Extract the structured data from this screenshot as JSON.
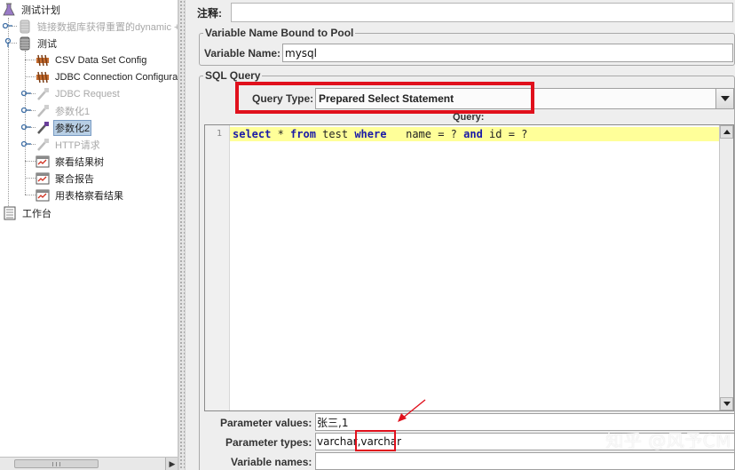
{
  "tree": {
    "nodes": [
      {
        "label": "测试计划",
        "icon": "flask-icon",
        "disabled": false,
        "selected": false
      },
      {
        "label": "链接数据库获得重置的dynamic +",
        "icon": "thread-group-icon",
        "disabled": true,
        "selected": false
      },
      {
        "label": "测试",
        "icon": "thread-group-icon",
        "disabled": false,
        "selected": false
      },
      {
        "label": "CSV Data Set Config",
        "icon": "config-element-icon",
        "disabled": false,
        "selected": false
      },
      {
        "label": "JDBC Connection Configurat",
        "icon": "config-element-icon",
        "disabled": false,
        "selected": false
      },
      {
        "label": "JDBC Request",
        "icon": "pipette-icon",
        "disabled": true,
        "selected": false
      },
      {
        "label": "参数化1",
        "icon": "pipette-icon",
        "disabled": true,
        "selected": false
      },
      {
        "label": "参数化2",
        "icon": "pipette-icon",
        "disabled": false,
        "selected": true
      },
      {
        "label": "HTTP请求",
        "icon": "pipette-icon",
        "disabled": true,
        "selected": false
      },
      {
        "label": "察看结果树",
        "icon": "listener-icon",
        "disabled": false,
        "selected": false
      },
      {
        "label": "聚合报告",
        "icon": "listener-icon",
        "disabled": false,
        "selected": false
      },
      {
        "label": "用表格察看结果",
        "icon": "listener-icon",
        "disabled": false,
        "selected": false
      },
      {
        "label": "工作台",
        "icon": "workbench-icon",
        "disabled": false,
        "selected": false
      }
    ]
  },
  "form": {
    "comment_label": "注释:",
    "variable_group_title": "Variable Name Bound to Pool",
    "variable_name_label": "Variable Name:",
    "variable_name_value": "mysql",
    "sql_group_title": "SQL Query",
    "query_type_label": "Query Type:",
    "query_type_value": "Prepared Select Statement",
    "query_label": "Query:",
    "editor": {
      "line_number": "1",
      "code": {
        "kw_select": "select",
        "t1": " * ",
        "kw_from": "from",
        "t2": " test ",
        "kw_where": "where",
        "t3": "   name = ? ",
        "kw_and": "and",
        "t4": " id = ?"
      }
    },
    "param_values_label": "Parameter values:",
    "param_values_value": "张三,1",
    "param_types_label": "Parameter types:",
    "param_types_value": "varchar,varchar",
    "variable_names_label": "Variable names:",
    "variable_names_value": ""
  },
  "watermark": "知乎 @风予CM",
  "colors": {
    "highlight_red": "#e0101c",
    "keyword_blue": "#1a1aa6",
    "current_line": "#ffff99",
    "selection": "#b8cfe5"
  }
}
